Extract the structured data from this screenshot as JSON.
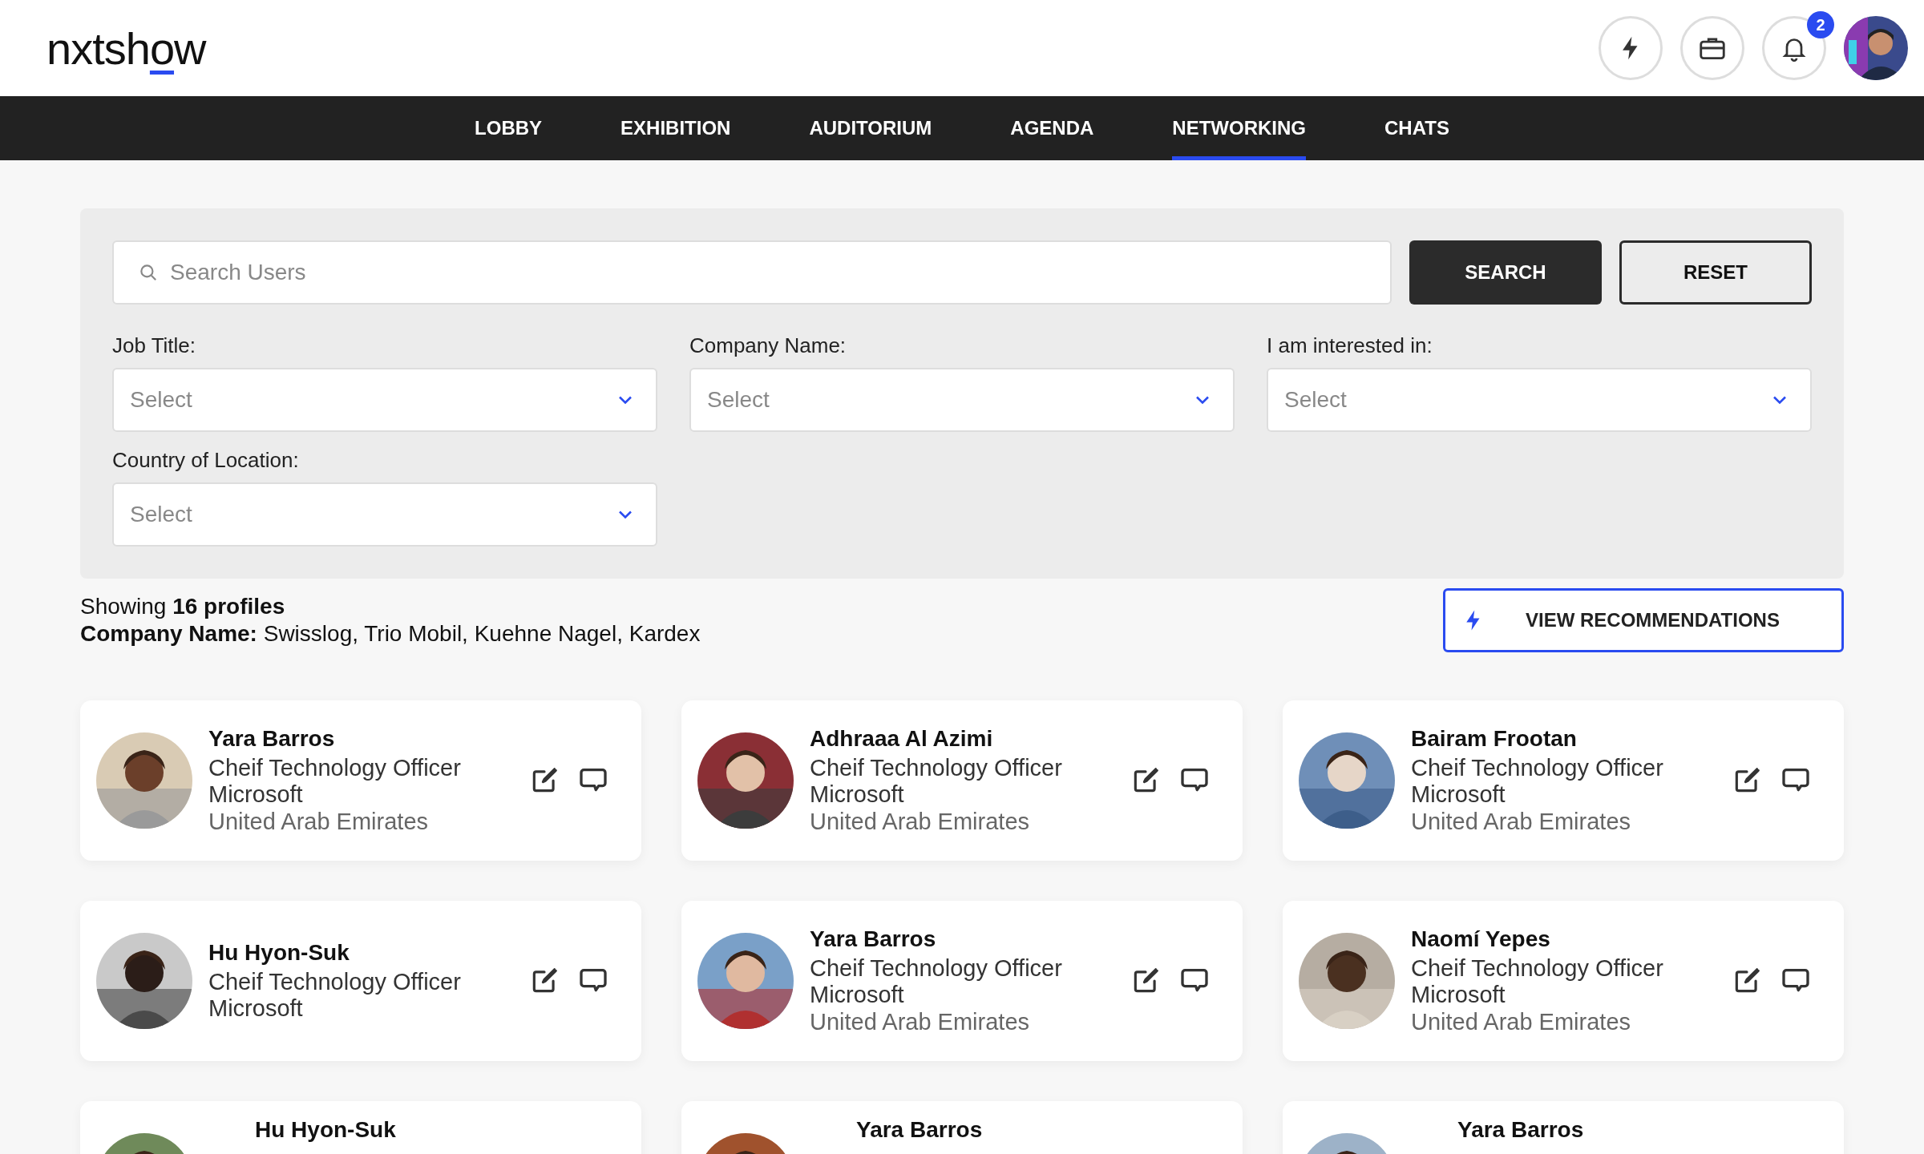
{
  "header": {
    "logo": "nxtshow",
    "notifications_badge": "2"
  },
  "nav": [
    {
      "label": "LOBBY",
      "selected": false
    },
    {
      "label": "EXHIBITION",
      "selected": false
    },
    {
      "label": "AUDITORIUM",
      "selected": false
    },
    {
      "label": "AGENDA",
      "selected": false
    },
    {
      "label": "NETWORKING",
      "selected": true
    },
    {
      "label": "CHATS",
      "selected": false
    }
  ],
  "search": {
    "placeholder": "Search Users",
    "search_button": "SEARCH",
    "reset_button": "RESET"
  },
  "filters": [
    {
      "label": "Job Title:",
      "placeholder": "Select"
    },
    {
      "label": "Company Name:",
      "placeholder": "Select"
    },
    {
      "label": "I am interested in:",
      "placeholder": "Select"
    },
    {
      "label": "Country of Location:",
      "placeholder": "Select"
    }
  ],
  "summary": {
    "count_line": "Showing **16 profiles**",
    "filter_line": "**Company Name:** Swisslog, Trio Mobil, Kuehne Nagel, Kardex"
  },
  "recommendations_button": "VIEW RECOMMENDATIONS",
  "profiles": [
    {
      "name": "Yara Barros",
      "title": "Cheif Technology Officer",
      "company": "Microsoft",
      "location": "United Arab Emirates"
    },
    {
      "name": "Adhraaa Al Azimi",
      "title": "Cheif Technology Officer",
      "company": "Microsoft",
      "location": "United Arab Emirates"
    },
    {
      "name": "Bairam Frootan",
      "title": "Cheif Technology Officer",
      "company": "Microsoft",
      "location": "United Arab Emirates"
    },
    {
      "name": "Hu Hyon-Suk",
      "title": "Cheif Technology Officer",
      "company": "Microsoft"
    },
    {
      "name": "Yara Barros",
      "title": "Cheif Technology Officer",
      "company": "Microsoft",
      "location": "United Arab Emirates"
    },
    {
      "name": "Naomí Yepes",
      "title": "Cheif Technology Officer",
      "company": "Microsoft",
      "location": "United Arab Emirates"
    },
    {
      "name": "Hu Hyon-Suk"
    },
    {
      "name": "Yara Barros"
    },
    {
      "name": "Yara Barros"
    }
  ]
}
